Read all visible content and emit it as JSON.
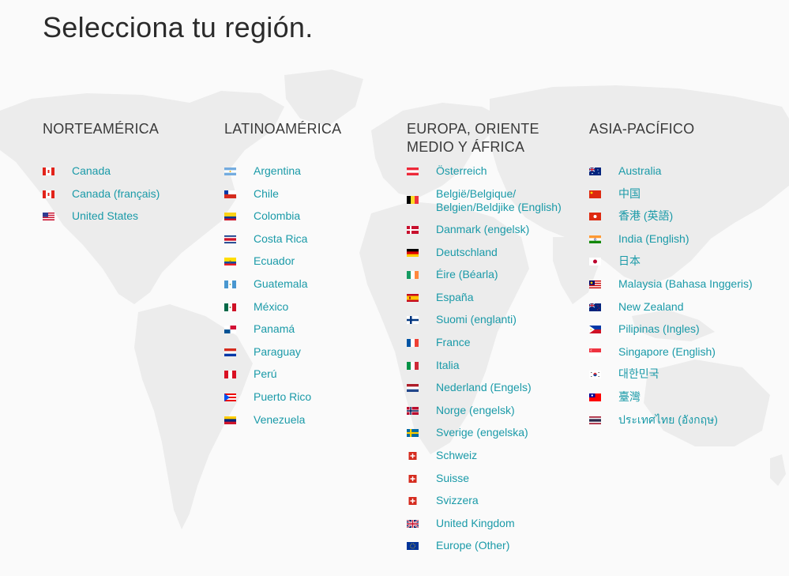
{
  "page_title": "Selecciona tu región.",
  "regions": [
    {
      "name": "NORTEAMÉRICA",
      "countries": [
        {
          "label": "Canada",
          "flag": "canada-flag-icon"
        },
        {
          "label": "Canada (français)",
          "flag": "canada-flag-icon"
        },
        {
          "label": "United States",
          "flag": "us-flag-icon"
        }
      ]
    },
    {
      "name": "LATINOAMÉRICA",
      "countries": [
        {
          "label": "Argentina",
          "flag": "argentina-flag-icon"
        },
        {
          "label": "Chile",
          "flag": "chile-flag-icon"
        },
        {
          "label": "Colombia",
          "flag": "colombia-flag-icon"
        },
        {
          "label": "Costa Rica",
          "flag": "costa-rica-flag-icon"
        },
        {
          "label": "Ecuador",
          "flag": "ecuador-flag-icon"
        },
        {
          "label": "Guatemala",
          "flag": "guatemala-flag-icon"
        },
        {
          "label": "México",
          "flag": "mexico-flag-icon"
        },
        {
          "label": "Panamá",
          "flag": "panama-flag-icon"
        },
        {
          "label": "Paraguay",
          "flag": "paraguay-flag-icon"
        },
        {
          "label": "Perú",
          "flag": "peru-flag-icon"
        },
        {
          "label": "Puerto Rico",
          "flag": "puerto-rico-flag-icon"
        },
        {
          "label": "Venezuela",
          "flag": "venezuela-flag-icon"
        }
      ]
    },
    {
      "name": "EUROPA, ORIENTE MEDIO Y ÁFRICA",
      "countries": [
        {
          "label": "Österreich",
          "flag": "austria-flag-icon"
        },
        {
          "label": "België/Belgique/ Belgien/Beldjike (English)",
          "flag": "belgium-flag-icon"
        },
        {
          "label": "Danmark (engelsk)",
          "flag": "denmark-flag-icon"
        },
        {
          "label": "Deutschland",
          "flag": "germany-flag-icon"
        },
        {
          "label": "Éire (Béarla)",
          "flag": "ireland-flag-icon"
        },
        {
          "label": "España",
          "flag": "spain-flag-icon"
        },
        {
          "label": "Suomi (englanti)",
          "flag": "finland-flag-icon"
        },
        {
          "label": "France",
          "flag": "france-flag-icon"
        },
        {
          "label": "Italia",
          "flag": "italy-flag-icon"
        },
        {
          "label": "Nederland (Engels)",
          "flag": "netherlands-flag-icon"
        },
        {
          "label": "Norge (engelsk)",
          "flag": "norway-flag-icon"
        },
        {
          "label": "Sverige (engelska)",
          "flag": "sweden-flag-icon"
        },
        {
          "label": "Schweiz",
          "flag": "switzerland-flag-icon"
        },
        {
          "label": "Suisse",
          "flag": "switzerland-flag-icon"
        },
        {
          "label": "Svizzera",
          "flag": "switzerland-flag-icon"
        },
        {
          "label": "United Kingdom",
          "flag": "uk-flag-icon"
        },
        {
          "label": "Europe (Other)",
          "flag": "eu-flag-icon"
        }
      ]
    },
    {
      "name": "ASIA-PACÍFICO",
      "countries": [
        {
          "label": "Australia",
          "flag": "australia-flag-icon"
        },
        {
          "label": "中国",
          "flag": "china-flag-icon"
        },
        {
          "label": "香港 (英語)",
          "flag": "hong-kong-flag-icon"
        },
        {
          "label": "India (English)",
          "flag": "india-flag-icon"
        },
        {
          "label": "日本",
          "flag": "japan-flag-icon"
        },
        {
          "label": "Malaysia (Bahasa Inggeris)",
          "flag": "malaysia-flag-icon"
        },
        {
          "label": "New Zealand",
          "flag": "new-zealand-flag-icon"
        },
        {
          "label": "Pilipinas (Ingles)",
          "flag": "philippines-flag-icon"
        },
        {
          "label": "Singapore (English)",
          "flag": "singapore-flag-icon"
        },
        {
          "label": "대한민국",
          "flag": "south-korea-flag-icon"
        },
        {
          "label": "臺灣",
          "flag": "taiwan-flag-icon"
        },
        {
          "label": "ประเทศไทย (อังกฤษ)",
          "flag": "thailand-flag-icon"
        }
      ]
    }
  ],
  "colors": {
    "link": "#1a9aa8",
    "heading": "#2b2b2b",
    "background": "#fafafa",
    "map": "#ececec"
  }
}
